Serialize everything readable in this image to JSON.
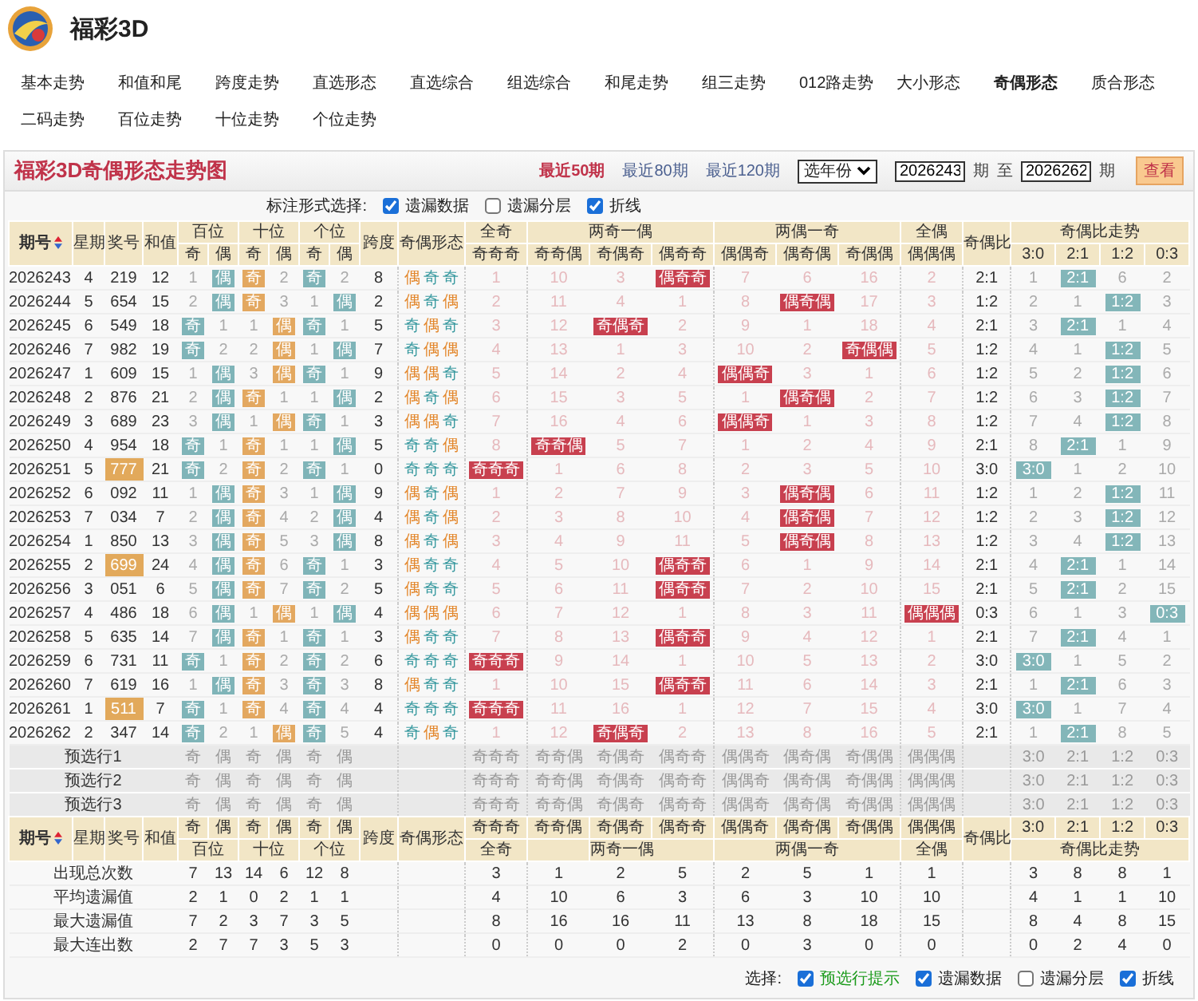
{
  "site": {
    "title": "福彩3D"
  },
  "nav": [
    {
      "label": "基本走势",
      "selected": false
    },
    {
      "label": "和值和尾",
      "selected": false
    },
    {
      "label": "跨度走势",
      "selected": false
    },
    {
      "label": "直选形态",
      "selected": false
    },
    {
      "label": "直选综合",
      "selected": false
    },
    {
      "label": "组选综合",
      "selected": false
    },
    {
      "label": "和尾走势",
      "selected": false
    },
    {
      "label": "组三走势",
      "selected": false
    },
    {
      "label": "012路走势",
      "selected": false
    },
    {
      "label": "大小形态",
      "selected": false
    },
    {
      "label": "奇偶形态",
      "selected": true
    },
    {
      "label": "质合形态",
      "selected": false
    },
    {
      "label": "二码走势",
      "selected": false
    },
    {
      "label": "百位走势",
      "selected": false
    },
    {
      "label": "十位走势",
      "selected": false
    },
    {
      "label": "个位走势",
      "selected": false
    }
  ],
  "panel": {
    "title": "福彩3D奇偶形态走势图",
    "periods": [
      {
        "label": "最近50期",
        "selected": true
      },
      {
        "label": "最近80期",
        "selected": false
      },
      {
        "label": "最近120期",
        "selected": false
      }
    ],
    "year_select": "选年份",
    "from_value": "2026243",
    "period_unit_1": "期",
    "to_label": "至",
    "to_value": "2026262",
    "period_unit_2": "期",
    "view_button": "查看"
  },
  "marking": {
    "label": "标注形式选择:",
    "options": [
      {
        "label": "遗漏数据",
        "checked": true
      },
      {
        "label": "遗漏分层",
        "checked": false
      },
      {
        "label": "折线",
        "checked": true
      }
    ]
  },
  "header": {
    "period": "期号",
    "weekday": "星期",
    "number": "奖号",
    "sum": "和值",
    "positions": [
      {
        "label": "百位",
        "odd": "奇",
        "even": "偶"
      },
      {
        "label": "十位",
        "odd": "奇",
        "even": "偶"
      },
      {
        "label": "个位",
        "odd": "奇",
        "even": "偶"
      }
    ],
    "span": "跨度",
    "form": "奇偶形态",
    "groups": [
      {
        "label": "全奇",
        "patterns": [
          "奇奇奇"
        ]
      },
      {
        "label": "两奇一偶",
        "patterns": [
          "奇奇偶",
          "奇偶奇",
          "偶奇奇"
        ]
      },
      {
        "label": "两偶一奇",
        "patterns": [
          "偶偶奇",
          "偶奇偶",
          "奇偶偶"
        ]
      },
      {
        "label": "全偶",
        "patterns": [
          "偶偶偶"
        ]
      }
    ],
    "ratio": "奇偶比",
    "trend_label": "奇偶比走势",
    "ratios": [
      "3:0",
      "2:1",
      "1:2",
      "0:3"
    ]
  },
  "rows": [
    {
      "period": "2026243",
      "weekday": "4",
      "number": "219",
      "highlighted": false,
      "sum": "12",
      "digits": [
        {
          "cells": [
            "1",
            "偶"
          ],
          "hit": [
            false,
            true
          ]
        },
        {
          "cells": [
            "奇",
            "2"
          ],
          "hit": [
            true,
            false
          ]
        },
        {
          "cells": [
            "奇",
            "2"
          ],
          "hit": [
            true,
            false
          ]
        }
      ],
      "span": "8",
      "form": [
        "偶",
        "奇",
        "奇"
      ],
      "patterns": {
        "cells": [
          "1",
          "10",
          "3",
          "偶奇奇",
          "7",
          "6",
          "16",
          "2"
        ],
        "hit": [
          false,
          false,
          false,
          true,
          false,
          false,
          false,
          false
        ]
      },
      "ratio": "2:1",
      "trend": {
        "cells": [
          "1",
          "2:1",
          "6",
          "2"
        ],
        "hit": [
          false,
          true,
          false,
          false
        ]
      }
    },
    {
      "period": "2026244",
      "weekday": "5",
      "number": "654",
      "highlighted": false,
      "sum": "15",
      "digits": [
        {
          "cells": [
            "2",
            "偶"
          ],
          "hit": [
            false,
            true
          ]
        },
        {
          "cells": [
            "奇",
            "3"
          ],
          "hit": [
            true,
            false
          ]
        },
        {
          "cells": [
            "1",
            "偶"
          ],
          "hit": [
            false,
            true
          ]
        }
      ],
      "span": "2",
      "form": [
        "偶",
        "奇",
        "偶"
      ],
      "patterns": {
        "cells": [
          "2",
          "11",
          "4",
          "1",
          "8",
          "偶奇偶",
          "17",
          "3"
        ],
        "hit": [
          false,
          false,
          false,
          false,
          false,
          true,
          false,
          false
        ]
      },
      "ratio": "1:2",
      "trend": {
        "cells": [
          "2",
          "1",
          "1:2",
          "3"
        ],
        "hit": [
          false,
          false,
          true,
          false
        ]
      }
    },
    {
      "period": "2026245",
      "weekday": "6",
      "number": "549",
      "highlighted": false,
      "sum": "18",
      "digits": [
        {
          "cells": [
            "奇",
            "1"
          ],
          "hit": [
            true,
            false
          ]
        },
        {
          "cells": [
            "1",
            "偶"
          ],
          "hit": [
            false,
            true
          ]
        },
        {
          "cells": [
            "奇",
            "1"
          ],
          "hit": [
            true,
            false
          ]
        }
      ],
      "span": "5",
      "form": [
        "奇",
        "偶",
        "奇"
      ],
      "patterns": {
        "cells": [
          "3",
          "12",
          "奇偶奇",
          "2",
          "9",
          "1",
          "18",
          "4"
        ],
        "hit": [
          false,
          false,
          true,
          false,
          false,
          false,
          false,
          false
        ]
      },
      "ratio": "2:1",
      "trend": {
        "cells": [
          "3",
          "2:1",
          "1",
          "4"
        ],
        "hit": [
          false,
          true,
          false,
          false
        ]
      }
    },
    {
      "period": "2026246",
      "weekday": "7",
      "number": "982",
      "highlighted": false,
      "sum": "19",
      "digits": [
        {
          "cells": [
            "奇",
            "2"
          ],
          "hit": [
            true,
            false
          ]
        },
        {
          "cells": [
            "2",
            "偶"
          ],
          "hit": [
            false,
            true
          ]
        },
        {
          "cells": [
            "1",
            "偶"
          ],
          "hit": [
            false,
            true
          ]
        }
      ],
      "span": "7",
      "form": [
        "奇",
        "偶",
        "偶"
      ],
      "patterns": {
        "cells": [
          "4",
          "13",
          "1",
          "3",
          "10",
          "2",
          "奇偶偶",
          "5"
        ],
        "hit": [
          false,
          false,
          false,
          false,
          false,
          false,
          true,
          false
        ]
      },
      "ratio": "1:2",
      "trend": {
        "cells": [
          "4",
          "1",
          "1:2",
          "5"
        ],
        "hit": [
          false,
          false,
          true,
          false
        ]
      }
    },
    {
      "period": "2026247",
      "weekday": "1",
      "number": "609",
      "highlighted": false,
      "sum": "15",
      "digits": [
        {
          "cells": [
            "1",
            "偶"
          ],
          "hit": [
            false,
            true
          ]
        },
        {
          "cells": [
            "3",
            "偶"
          ],
          "hit": [
            false,
            true
          ]
        },
        {
          "cells": [
            "奇",
            "1"
          ],
          "hit": [
            true,
            false
          ]
        }
      ],
      "span": "9",
      "form": [
        "偶",
        "偶",
        "奇"
      ],
      "patterns": {
        "cells": [
          "5",
          "14",
          "2",
          "4",
          "偶偶奇",
          "3",
          "1",
          "6"
        ],
        "hit": [
          false,
          false,
          false,
          false,
          true,
          false,
          false,
          false
        ]
      },
      "ratio": "1:2",
      "trend": {
        "cells": [
          "5",
          "2",
          "1:2",
          "6"
        ],
        "hit": [
          false,
          false,
          true,
          false
        ]
      }
    },
    {
      "period": "2026248",
      "weekday": "2",
      "number": "876",
      "highlighted": false,
      "sum": "21",
      "digits": [
        {
          "cells": [
            "2",
            "偶"
          ],
          "hit": [
            false,
            true
          ]
        },
        {
          "cells": [
            "奇",
            "1"
          ],
          "hit": [
            true,
            false
          ]
        },
        {
          "cells": [
            "1",
            "偶"
          ],
          "hit": [
            false,
            true
          ]
        }
      ],
      "span": "2",
      "form": [
        "偶",
        "奇",
        "偶"
      ],
      "patterns": {
        "cells": [
          "6",
          "15",
          "3",
          "5",
          "1",
          "偶奇偶",
          "2",
          "7"
        ],
        "hit": [
          false,
          false,
          false,
          false,
          false,
          true,
          false,
          false
        ]
      },
      "ratio": "1:2",
      "trend": {
        "cells": [
          "6",
          "3",
          "1:2",
          "7"
        ],
        "hit": [
          false,
          false,
          true,
          false
        ]
      }
    },
    {
      "period": "2026249",
      "weekday": "3",
      "number": "689",
      "highlighted": false,
      "sum": "23",
      "digits": [
        {
          "cells": [
            "3",
            "偶"
          ],
          "hit": [
            false,
            true
          ]
        },
        {
          "cells": [
            "1",
            "偶"
          ],
          "hit": [
            false,
            true
          ]
        },
        {
          "cells": [
            "奇",
            "1"
          ],
          "hit": [
            true,
            false
          ]
        }
      ],
      "span": "3",
      "form": [
        "偶",
        "偶",
        "奇"
      ],
      "patterns": {
        "cells": [
          "7",
          "16",
          "4",
          "6",
          "偶偶奇",
          "1",
          "3",
          "8"
        ],
        "hit": [
          false,
          false,
          false,
          false,
          true,
          false,
          false,
          false
        ]
      },
      "ratio": "1:2",
      "trend": {
        "cells": [
          "7",
          "4",
          "1:2",
          "8"
        ],
        "hit": [
          false,
          false,
          true,
          false
        ]
      }
    },
    {
      "period": "2026250",
      "weekday": "4",
      "number": "954",
      "highlighted": false,
      "sum": "18",
      "digits": [
        {
          "cells": [
            "奇",
            "1"
          ],
          "hit": [
            true,
            false
          ]
        },
        {
          "cells": [
            "奇",
            "1"
          ],
          "hit": [
            true,
            false
          ]
        },
        {
          "cells": [
            "1",
            "偶"
          ],
          "hit": [
            false,
            true
          ]
        }
      ],
      "span": "5",
      "form": [
        "奇",
        "奇",
        "偶"
      ],
      "patterns": {
        "cells": [
          "8",
          "奇奇偶",
          "5",
          "7",
          "1",
          "2",
          "4",
          "9"
        ],
        "hit": [
          false,
          true,
          false,
          false,
          false,
          false,
          false,
          false
        ]
      },
      "ratio": "2:1",
      "trend": {
        "cells": [
          "8",
          "2:1",
          "1",
          "9"
        ],
        "hit": [
          false,
          true,
          false,
          false
        ]
      }
    },
    {
      "period": "2026251",
      "weekday": "5",
      "number": "777",
      "highlighted": true,
      "sum": "21",
      "digits": [
        {
          "cells": [
            "奇",
            "2"
          ],
          "hit": [
            true,
            false
          ]
        },
        {
          "cells": [
            "奇",
            "2"
          ],
          "hit": [
            true,
            false
          ]
        },
        {
          "cells": [
            "奇",
            "1"
          ],
          "hit": [
            true,
            false
          ]
        }
      ],
      "span": "0",
      "form": [
        "奇",
        "奇",
        "奇"
      ],
      "patterns": {
        "cells": [
          "奇奇奇",
          "1",
          "6",
          "8",
          "2",
          "3",
          "5",
          "10"
        ],
        "hit": [
          true,
          false,
          false,
          false,
          false,
          false,
          false,
          false
        ]
      },
      "ratio": "3:0",
      "trend": {
        "cells": [
          "3:0",
          "1",
          "2",
          "10"
        ],
        "hit": [
          true,
          false,
          false,
          false
        ]
      }
    },
    {
      "period": "2026252",
      "weekday": "6",
      "number": "092",
      "highlighted": false,
      "sum": "11",
      "digits": [
        {
          "cells": [
            "1",
            "偶"
          ],
          "hit": [
            false,
            true
          ]
        },
        {
          "cells": [
            "奇",
            "3"
          ],
          "hit": [
            true,
            false
          ]
        },
        {
          "cells": [
            "1",
            "偶"
          ],
          "hit": [
            false,
            true
          ]
        }
      ],
      "span": "9",
      "form": [
        "偶",
        "奇",
        "偶"
      ],
      "patterns": {
        "cells": [
          "1",
          "2",
          "7",
          "9",
          "3",
          "偶奇偶",
          "6",
          "11"
        ],
        "hit": [
          false,
          false,
          false,
          false,
          false,
          true,
          false,
          false
        ]
      },
      "ratio": "1:2",
      "trend": {
        "cells": [
          "1",
          "2",
          "1:2",
          "11"
        ],
        "hit": [
          false,
          false,
          true,
          false
        ]
      }
    },
    {
      "period": "2026253",
      "weekday": "7",
      "number": "034",
      "highlighted": false,
      "sum": "7",
      "digits": [
        {
          "cells": [
            "2",
            "偶"
          ],
          "hit": [
            false,
            true
          ]
        },
        {
          "cells": [
            "奇",
            "4"
          ],
          "hit": [
            true,
            false
          ]
        },
        {
          "cells": [
            "2",
            "偶"
          ],
          "hit": [
            false,
            true
          ]
        }
      ],
      "span": "4",
      "form": [
        "偶",
        "奇",
        "偶"
      ],
      "patterns": {
        "cells": [
          "2",
          "3",
          "8",
          "10",
          "4",
          "偶奇偶",
          "7",
          "12"
        ],
        "hit": [
          false,
          false,
          false,
          false,
          false,
          true,
          false,
          false
        ]
      },
      "ratio": "1:2",
      "trend": {
        "cells": [
          "2",
          "3",
          "1:2",
          "12"
        ],
        "hit": [
          false,
          false,
          true,
          false
        ]
      }
    },
    {
      "period": "2026254",
      "weekday": "1",
      "number": "850",
      "highlighted": false,
      "sum": "13",
      "digits": [
        {
          "cells": [
            "3",
            "偶"
          ],
          "hit": [
            false,
            true
          ]
        },
        {
          "cells": [
            "奇",
            "5"
          ],
          "hit": [
            true,
            false
          ]
        },
        {
          "cells": [
            "3",
            "偶"
          ],
          "hit": [
            false,
            true
          ]
        }
      ],
      "span": "8",
      "form": [
        "偶",
        "奇",
        "偶"
      ],
      "patterns": {
        "cells": [
          "3",
          "4",
          "9",
          "11",
          "5",
          "偶奇偶",
          "8",
          "13"
        ],
        "hit": [
          false,
          false,
          false,
          false,
          false,
          true,
          false,
          false
        ]
      },
      "ratio": "1:2",
      "trend": {
        "cells": [
          "3",
          "4",
          "1:2",
          "13"
        ],
        "hit": [
          false,
          false,
          true,
          false
        ]
      }
    },
    {
      "period": "2026255",
      "weekday": "2",
      "number": "699",
      "highlighted": true,
      "sum": "24",
      "digits": [
        {
          "cells": [
            "4",
            "偶"
          ],
          "hit": [
            false,
            true
          ]
        },
        {
          "cells": [
            "奇",
            "6"
          ],
          "hit": [
            true,
            false
          ]
        },
        {
          "cells": [
            "奇",
            "1"
          ],
          "hit": [
            true,
            false
          ]
        }
      ],
      "span": "3",
      "form": [
        "偶",
        "奇",
        "奇"
      ],
      "patterns": {
        "cells": [
          "4",
          "5",
          "10",
          "偶奇奇",
          "6",
          "1",
          "9",
          "14"
        ],
        "hit": [
          false,
          false,
          false,
          true,
          false,
          false,
          false,
          false
        ]
      },
      "ratio": "2:1",
      "trend": {
        "cells": [
          "4",
          "2:1",
          "1",
          "14"
        ],
        "hit": [
          false,
          true,
          false,
          false
        ]
      }
    },
    {
      "period": "2026256",
      "weekday": "3",
      "number": "051",
      "highlighted": false,
      "sum": "6",
      "digits": [
        {
          "cells": [
            "5",
            "偶"
          ],
          "hit": [
            false,
            true
          ]
        },
        {
          "cells": [
            "奇",
            "7"
          ],
          "hit": [
            true,
            false
          ]
        },
        {
          "cells": [
            "奇",
            "2"
          ],
          "hit": [
            true,
            false
          ]
        }
      ],
      "span": "5",
      "form": [
        "偶",
        "奇",
        "奇"
      ],
      "patterns": {
        "cells": [
          "5",
          "6",
          "11",
          "偶奇奇",
          "7",
          "2",
          "10",
          "15"
        ],
        "hit": [
          false,
          false,
          false,
          true,
          false,
          false,
          false,
          false
        ]
      },
      "ratio": "2:1",
      "trend": {
        "cells": [
          "5",
          "2:1",
          "2",
          "15"
        ],
        "hit": [
          false,
          true,
          false,
          false
        ]
      }
    },
    {
      "period": "2026257",
      "weekday": "4",
      "number": "486",
      "highlighted": false,
      "sum": "18",
      "digits": [
        {
          "cells": [
            "6",
            "偶"
          ],
          "hit": [
            false,
            true
          ]
        },
        {
          "cells": [
            "1",
            "偶"
          ],
          "hit": [
            false,
            true
          ]
        },
        {
          "cells": [
            "1",
            "偶"
          ],
          "hit": [
            false,
            true
          ]
        }
      ],
      "span": "4",
      "form": [
        "偶",
        "偶",
        "偶"
      ],
      "patterns": {
        "cells": [
          "6",
          "7",
          "12",
          "1",
          "8",
          "3",
          "11",
          "偶偶偶"
        ],
        "hit": [
          false,
          false,
          false,
          false,
          false,
          false,
          false,
          true
        ]
      },
      "ratio": "0:3",
      "trend": {
        "cells": [
          "6",
          "1",
          "3",
          "0:3"
        ],
        "hit": [
          false,
          false,
          false,
          true
        ]
      }
    },
    {
      "period": "2026258",
      "weekday": "5",
      "number": "635",
      "highlighted": false,
      "sum": "14",
      "digits": [
        {
          "cells": [
            "7",
            "偶"
          ],
          "hit": [
            false,
            true
          ]
        },
        {
          "cells": [
            "奇",
            "1"
          ],
          "hit": [
            true,
            false
          ]
        },
        {
          "cells": [
            "奇",
            "1"
          ],
          "hit": [
            true,
            false
          ]
        }
      ],
      "span": "3",
      "form": [
        "偶",
        "奇",
        "奇"
      ],
      "patterns": {
        "cells": [
          "7",
          "8",
          "13",
          "偶奇奇",
          "9",
          "4",
          "12",
          "1"
        ],
        "hit": [
          false,
          false,
          false,
          true,
          false,
          false,
          false,
          false
        ]
      },
      "ratio": "2:1",
      "trend": {
        "cells": [
          "7",
          "2:1",
          "4",
          "1"
        ],
        "hit": [
          false,
          true,
          false,
          false
        ]
      }
    },
    {
      "period": "2026259",
      "weekday": "6",
      "number": "731",
      "highlighted": false,
      "sum": "11",
      "digits": [
        {
          "cells": [
            "奇",
            "1"
          ],
          "hit": [
            true,
            false
          ]
        },
        {
          "cells": [
            "奇",
            "2"
          ],
          "hit": [
            true,
            false
          ]
        },
        {
          "cells": [
            "奇",
            "2"
          ],
          "hit": [
            true,
            false
          ]
        }
      ],
      "span": "6",
      "form": [
        "奇",
        "奇",
        "奇"
      ],
      "patterns": {
        "cells": [
          "奇奇奇",
          "9",
          "14",
          "1",
          "10",
          "5",
          "13",
          "2"
        ],
        "hit": [
          true,
          false,
          false,
          false,
          false,
          false,
          false,
          false
        ]
      },
      "ratio": "3:0",
      "trend": {
        "cells": [
          "3:0",
          "1",
          "5",
          "2"
        ],
        "hit": [
          true,
          false,
          false,
          false
        ]
      }
    },
    {
      "period": "2026260",
      "weekday": "7",
      "number": "619",
      "highlighted": false,
      "sum": "16",
      "digits": [
        {
          "cells": [
            "1",
            "偶"
          ],
          "hit": [
            false,
            true
          ]
        },
        {
          "cells": [
            "奇",
            "3"
          ],
          "hit": [
            true,
            false
          ]
        },
        {
          "cells": [
            "奇",
            "3"
          ],
          "hit": [
            true,
            false
          ]
        }
      ],
      "span": "8",
      "form": [
        "偶",
        "奇",
        "奇"
      ],
      "patterns": {
        "cells": [
          "1",
          "10",
          "15",
          "偶奇奇",
          "11",
          "6",
          "14",
          "3"
        ],
        "hit": [
          false,
          false,
          false,
          true,
          false,
          false,
          false,
          false
        ]
      },
      "ratio": "2:1",
      "trend": {
        "cells": [
          "1",
          "2:1",
          "6",
          "3"
        ],
        "hit": [
          false,
          true,
          false,
          false
        ]
      }
    },
    {
      "period": "2026261",
      "weekday": "1",
      "number": "511",
      "highlighted": true,
      "sum": "7",
      "digits": [
        {
          "cells": [
            "奇",
            "1"
          ],
          "hit": [
            true,
            false
          ]
        },
        {
          "cells": [
            "奇",
            "4"
          ],
          "hit": [
            true,
            false
          ]
        },
        {
          "cells": [
            "奇",
            "4"
          ],
          "hit": [
            true,
            false
          ]
        }
      ],
      "span": "4",
      "form": [
        "奇",
        "奇",
        "奇"
      ],
      "patterns": {
        "cells": [
          "奇奇奇",
          "11",
          "16",
          "1",
          "12",
          "7",
          "15",
          "4"
        ],
        "hit": [
          true,
          false,
          false,
          false,
          false,
          false,
          false,
          false
        ]
      },
      "ratio": "3:0",
      "trend": {
        "cells": [
          "3:0",
          "1",
          "7",
          "4"
        ],
        "hit": [
          true,
          false,
          false,
          false
        ]
      }
    },
    {
      "period": "2026262",
      "weekday": "2",
      "number": "347",
      "highlighted": false,
      "sum": "14",
      "digits": [
        {
          "cells": [
            "奇",
            "2"
          ],
          "hit": [
            true,
            false
          ]
        },
        {
          "cells": [
            "1",
            "偶"
          ],
          "hit": [
            false,
            true
          ]
        },
        {
          "cells": [
            "奇",
            "5"
          ],
          "hit": [
            true,
            false
          ]
        }
      ],
      "span": "4",
      "form": [
        "奇",
        "偶",
        "奇"
      ],
      "patterns": {
        "cells": [
          "1",
          "12",
          "奇偶奇",
          "2",
          "13",
          "8",
          "16",
          "5"
        ],
        "hit": [
          false,
          false,
          true,
          false,
          false,
          false,
          false,
          false
        ]
      },
      "ratio": "2:1",
      "trend": {
        "cells": [
          "1",
          "2:1",
          "8",
          "5"
        ],
        "hit": [
          false,
          true,
          false,
          false
        ]
      }
    }
  ],
  "preselect_rows": [
    {
      "label": "预选行1",
      "digits": [
        "奇",
        "偶",
        "奇",
        "偶",
        "奇",
        "偶"
      ],
      "patterns": [
        "奇奇奇",
        "奇奇偶",
        "奇偶奇",
        "偶奇奇",
        "偶偶奇",
        "偶奇偶",
        "奇偶偶",
        "偶偶偶"
      ],
      "ratios": [
        "3:0",
        "2:1",
        "1:2",
        "0:3"
      ]
    },
    {
      "label": "预选行2",
      "digits": [
        "奇",
        "偶",
        "奇",
        "偶",
        "奇",
        "偶"
      ],
      "patterns": [
        "奇奇奇",
        "奇奇偶",
        "奇偶奇",
        "偶奇奇",
        "偶偶奇",
        "偶奇偶",
        "奇偶偶",
        "偶偶偶"
      ],
      "ratios": [
        "3:0",
        "2:1",
        "1:2",
        "0:3"
      ]
    },
    {
      "label": "预选行3",
      "digits": [
        "奇",
        "偶",
        "奇",
        "偶",
        "奇",
        "偶"
      ],
      "patterns": [
        "奇奇奇",
        "奇奇偶",
        "奇偶奇",
        "偶奇奇",
        "偶偶奇",
        "偶奇偶",
        "奇偶偶",
        "偶偶偶"
      ],
      "ratios": [
        "3:0",
        "2:1",
        "1:2",
        "0:3"
      ]
    }
  ],
  "footer_header": {
    "period": "期号",
    "weekday": "星期",
    "number": "奖号",
    "sum": "和值",
    "digit_labels": [
      "奇",
      "偶",
      "奇",
      "偶",
      "奇",
      "偶"
    ],
    "span": "跨度",
    "form": "奇偶形态",
    "patterns": [
      "奇奇奇",
      "奇奇偶",
      "奇偶奇",
      "偶奇奇",
      "偶偶奇",
      "偶奇偶",
      "奇偶偶",
      "偶偶偶"
    ],
    "ratio": "奇偶比",
    "ratios": [
      "3:0",
      "2:1",
      "1:2",
      "0:3"
    ],
    "positions": [
      "百位",
      "十位",
      "个位"
    ],
    "groups": [
      "全奇",
      "两奇一偶",
      "两偶一奇",
      "全偶"
    ],
    "trend_label": "奇偶比走势"
  },
  "stats": [
    {
      "label": "出现总次数",
      "digits": [
        "7",
        "13",
        "14",
        "6",
        "12",
        "8"
      ],
      "patterns": [
        "3",
        "1",
        "2",
        "5",
        "2",
        "5",
        "1",
        "1"
      ],
      "trend": [
        "3",
        "8",
        "8",
        "1"
      ]
    },
    {
      "label": "平均遗漏值",
      "digits": [
        "2",
        "1",
        "0",
        "2",
        "1",
        "1"
      ],
      "patterns": [
        "4",
        "10",
        "6",
        "3",
        "6",
        "3",
        "10",
        "10"
      ],
      "trend": [
        "4",
        "1",
        "1",
        "10"
      ]
    },
    {
      "label": "最大遗漏值",
      "digits": [
        "7",
        "2",
        "3",
        "7",
        "3",
        "5"
      ],
      "patterns": [
        "8",
        "16",
        "16",
        "11",
        "13",
        "8",
        "18",
        "15"
      ],
      "trend": [
        "8",
        "4",
        "8",
        "15"
      ]
    },
    {
      "label": "最大连出数",
      "digits": [
        "2",
        "7",
        "7",
        "3",
        "5",
        "3"
      ],
      "patterns": [
        "0",
        "0",
        "0",
        "2",
        "0",
        "3",
        "0",
        "0"
      ],
      "trend": [
        "0",
        "2",
        "4",
        "0"
      ]
    }
  ],
  "bottom_options": {
    "label": "选择:",
    "options": [
      {
        "label": "预选行提示",
        "checked": true,
        "kind": "hint"
      },
      {
        "label": "遗漏数据",
        "checked": true,
        "kind": "plain"
      },
      {
        "label": "遗漏分层",
        "checked": false,
        "kind": "plain"
      },
      {
        "label": "折线",
        "checked": true,
        "kind": "plain"
      }
    ]
  }
}
